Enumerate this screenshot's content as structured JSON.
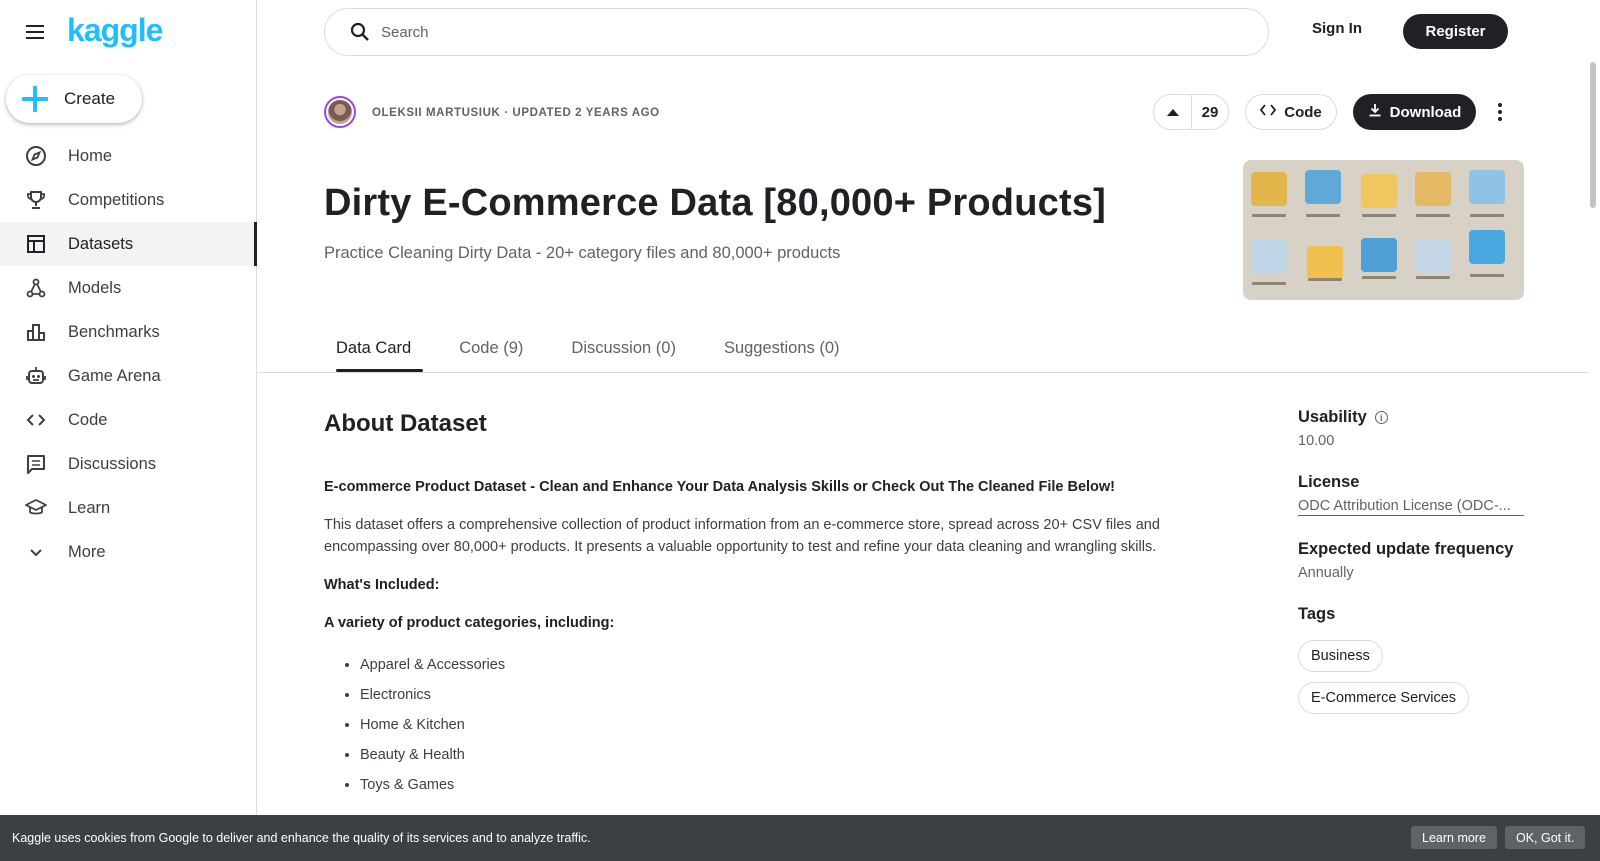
{
  "brand": {
    "logo_text": "kaggle",
    "accent": "#20beff"
  },
  "sidebar": {
    "create_label": "Create",
    "items": [
      {
        "label": "Home",
        "icon": "compass-icon"
      },
      {
        "label": "Competitions",
        "icon": "trophy-icon"
      },
      {
        "label": "Datasets",
        "icon": "table-icon",
        "active": true
      },
      {
        "label": "Models",
        "icon": "models-icon"
      },
      {
        "label": "Benchmarks",
        "icon": "bar-chart-icon"
      },
      {
        "label": "Game Arena",
        "icon": "robot-icon"
      },
      {
        "label": "Code",
        "icon": "code-icon"
      },
      {
        "label": "Discussions",
        "icon": "comment-icon"
      },
      {
        "label": "Learn",
        "icon": "graduation-cap-icon"
      },
      {
        "label": "More",
        "icon": "chevron-down-icon"
      }
    ]
  },
  "topbar": {
    "search_placeholder": "Search",
    "signin_label": "Sign In",
    "register_label": "Register"
  },
  "dataset": {
    "byline": "OLEKSII MARTUSIUK · UPDATED 2 YEARS AGO",
    "votes": "29",
    "code_label": "Code",
    "download_label": "Download",
    "title": "Dirty E-Commerce Data [80,000+ Products]",
    "subtitle": "Practice Cleaning Dirty Data - 20+ category files and 80,000+ products"
  },
  "tabs": [
    "Data Card",
    "Code (9)",
    "Discussion (0)",
    "Suggestions (0)"
  ],
  "about": {
    "heading": "About Dataset",
    "lead": "E-commerce Product Dataset - Clean and Enhance Your Data Analysis Skills or Check Out The Cleaned File Below!",
    "para": "This dataset offers a comprehensive collection of product information from an e-commerce store, spread across 20+ CSV files and encompassing over 80,000+ products. It presents a valuable opportunity to test and refine your data cleaning and wrangling skills.",
    "included_heading": "What's Included:",
    "categories_heading": "A variety of product categories, including:",
    "categories": [
      "Apparel & Accessories",
      "Electronics",
      "Home & Kitchen",
      "Beauty & Health",
      "Toys & Games"
    ]
  },
  "panel": {
    "usability_label": "Usability",
    "usability_value": "10.00",
    "license_label": "License",
    "license_value": "ODC Attribution License (ODC-...",
    "frequency_label": "Expected update frequency",
    "frequency_value": "Annually",
    "tags_label": "Tags",
    "tags": [
      "Business",
      "E-Commerce Services"
    ]
  },
  "cookie": {
    "message": "Kaggle uses cookies from Google to deliver and enhance the quality of its services and to analyze traffic.",
    "learn_more": "Learn more",
    "ok": "OK, Got it."
  }
}
